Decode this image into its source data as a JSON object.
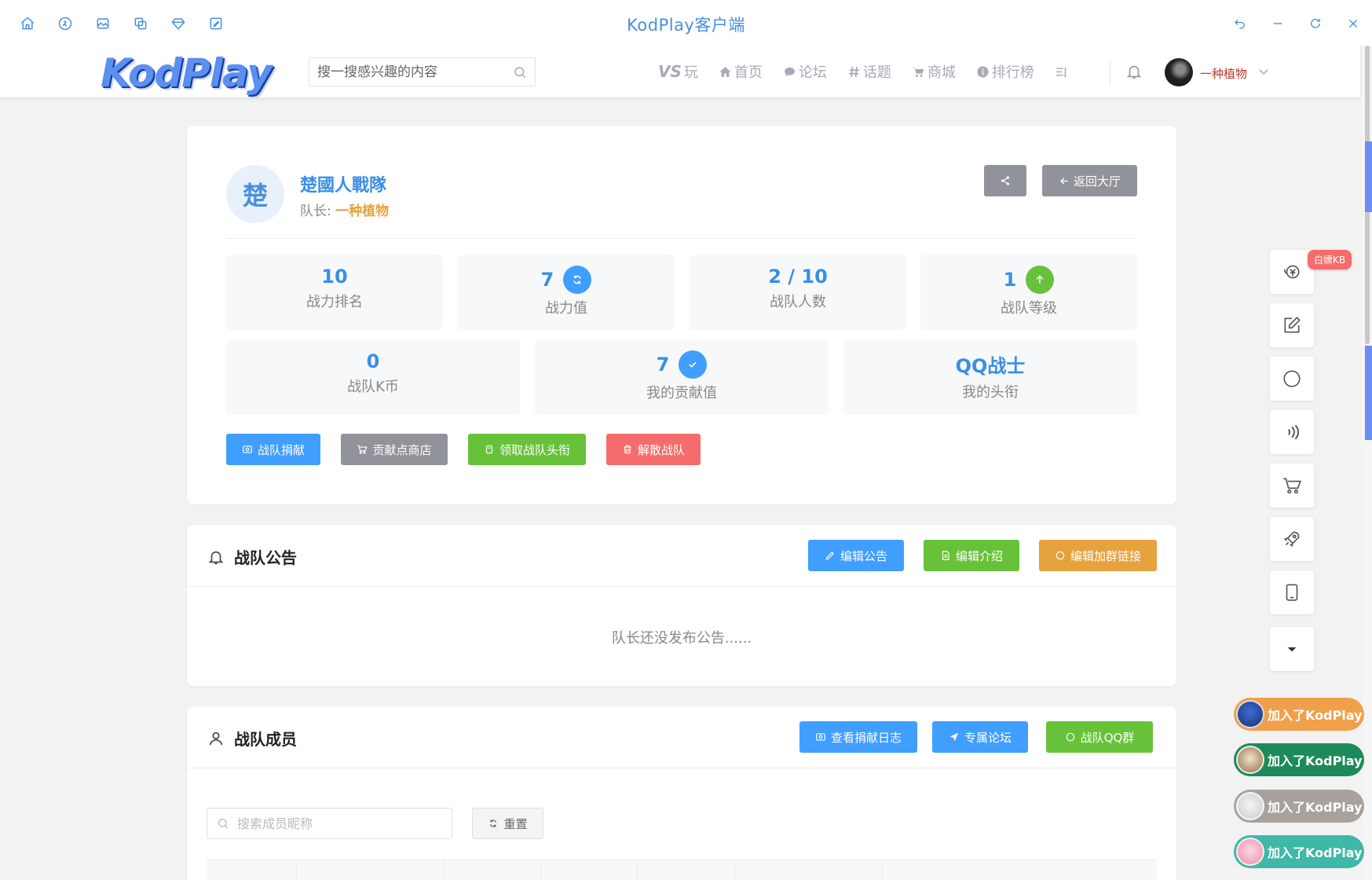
{
  "window": {
    "title": "KodPlay客户端"
  },
  "navbar": {
    "logo": "KodPlay",
    "search_placeholder": "搜一搜感兴趣的内容",
    "vs_mark": "VS",
    "vs_label": "玩",
    "items": [
      "首页",
      "论坛",
      "话题",
      "商城",
      "排行榜"
    ],
    "user_name": "一种植物"
  },
  "team": {
    "avatar_char": "楚",
    "name": "楚國人戰隊",
    "leader_label": "队长: ",
    "leader_name": "一种植物",
    "back_label": "返回大厅"
  },
  "stats": [
    {
      "value": "10",
      "label": "战力排名"
    },
    {
      "value": "7",
      "label": "战力值"
    },
    {
      "value": "2 / 10",
      "label": "战队人数"
    },
    {
      "value": "1",
      "label": "战队等级"
    },
    {
      "value": "0",
      "label": "战队K币"
    },
    {
      "value": "7",
      "label": "我的贡献值"
    },
    {
      "value": "QQ战士",
      "label": "我的头衔"
    }
  ],
  "actions": {
    "donate": "战队捐献",
    "shop": "贡献点商店",
    "claim_title": "领取战队头衔",
    "disband": "解散战队"
  },
  "announcement": {
    "title": "战队公告",
    "edit_notice": "编辑公告",
    "edit_intro": "编辑介绍",
    "edit_link": "编辑加群链接",
    "empty": "队长还没发布公告......"
  },
  "members": {
    "title": "战队成员",
    "view_log": "查看捐献日志",
    "forum": "专属论坛",
    "qq_group": "战队QQ群",
    "search_placeholder": "搜索成员昵称",
    "reset": "重置"
  },
  "sidebar": {
    "earn_badge": "白嫖KB"
  },
  "toasts": [
    {
      "text": "加入了KodPlay",
      "color": "#f0a04b"
    },
    {
      "text": "加入了KodPlay",
      "color": "#1d8a5a"
    },
    {
      "text": "加入了KodPlay",
      "color": "#a8a29e"
    },
    {
      "text": "加入了KodPlay",
      "color": "#3fb8a8"
    }
  ],
  "colors": {
    "primary": "#409eff",
    "gray": "#909399",
    "success": "#67c23a",
    "danger": "#f56c6c",
    "warning": "#e6a23c"
  }
}
